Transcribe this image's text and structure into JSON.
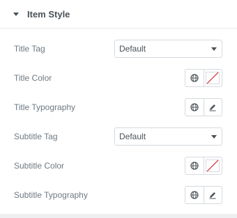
{
  "section": {
    "title": "Item Style",
    "icon": "caret-down-icon"
  },
  "rows": [
    {
      "label": "Title Tag",
      "type": "select",
      "value": "Default"
    },
    {
      "label": "Title Color",
      "type": "color"
    },
    {
      "label": "Title Typography",
      "type": "typography"
    },
    {
      "label": "Subtitle Tag",
      "type": "select",
      "value": "Default"
    },
    {
      "label": "Subtitle Color",
      "type": "color"
    },
    {
      "label": "Subtitle Typography",
      "type": "typography"
    }
  ],
  "colors": {
    "label": "#6d7882",
    "heading": "#495157",
    "border": "#d5dadf",
    "no_color_slash": "#d72b2b"
  }
}
